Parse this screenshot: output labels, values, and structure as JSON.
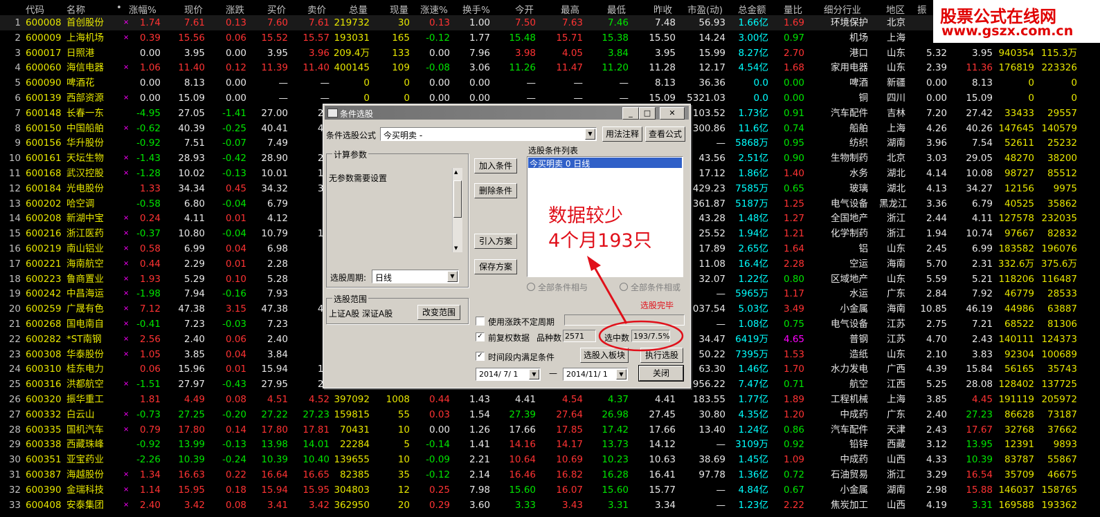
{
  "headers": [
    "代码",
    "名称",
    "•",
    "涨幅%",
    "现价",
    "涨跌",
    "买价",
    "卖价",
    "总量",
    "现量",
    "涨速%",
    "换手%",
    "今开",
    "最高",
    "最低",
    "昨收",
    "市盈(动)",
    "总金额",
    "量比",
    "细分行业",
    "地区",
    "振"
  ],
  "rows": [
    [
      "1",
      "600008",
      "首创股份",
      "×",
      "1.74",
      "7.61",
      "0.13",
      "7.60",
      "7.61",
      "219732",
      "30",
      "0.13",
      "1.00",
      "7.50",
      "7.63",
      "7.46",
      "7.48",
      "56.93",
      "1.66亿",
      "1.69",
      "环境保护",
      "北京",
      "",
      "",
      "",
      ""
    ],
    [
      "2",
      "600009",
      "上海机场",
      "×",
      "0.39",
      "15.56",
      "0.06",
      "15.52",
      "15.57",
      "193031",
      "165",
      "-0.12",
      "1.77",
      "15.48",
      "15.71",
      "15.38",
      "15.50",
      "14.24",
      "3.00亿",
      "0.97",
      "机场",
      "上海",
      "",
      "",
      "",
      ""
    ],
    [
      "3",
      "600017",
      "日照港",
      "",
      "0.00",
      "3.95",
      "0.00",
      "3.95",
      "3.96",
      "209.4万",
      "133",
      "0.00",
      "7.96",
      "3.98",
      "4.05",
      "3.84",
      "3.95",
      "15.99",
      "8.27亿",
      "2.70",
      "港口",
      "山东",
      "5.32",
      "3.95",
      "940354",
      "115.3万"
    ],
    [
      "4",
      "600060",
      "海信电器",
      "×",
      "1.06",
      "11.40",
      "0.12",
      "11.39",
      "11.40",
      "400145",
      "109",
      "-0.08",
      "3.06",
      "11.26",
      "11.47",
      "11.20",
      "11.28",
      "12.17",
      "4.54亿",
      "1.68",
      "家用电器",
      "山东",
      "2.39",
      "11.36",
      "176819",
      "223326"
    ],
    [
      "5",
      "600090",
      "啤酒花",
      "",
      "0.00",
      "8.13",
      "0.00",
      "—",
      "—",
      "0",
      "0",
      "0.00",
      "0.00",
      "—",
      "—",
      "—",
      "8.13",
      "36.36",
      "0.0",
      "0.00",
      "啤酒",
      "新疆",
      "0.00",
      "8.13",
      "0",
      "0"
    ],
    [
      "6",
      "600139",
      "西部资源",
      "×",
      "0.00",
      "15.09",
      "0.00",
      "—",
      "—",
      "0",
      "0",
      "0.00",
      "0.00",
      "—",
      "—",
      "—",
      "15.09",
      "5321.03",
      "0.0",
      "0.00",
      "铜",
      "四川",
      "0.00",
      "15.09",
      "0",
      "0"
    ],
    [
      "7",
      "600148",
      "长春一东",
      "",
      "-4.95",
      "27.05",
      "-1.41",
      "27.00",
      "27",
      "",
      "",
      "",
      "",
      "",
      "",
      "",
      "",
      "103.52",
      "1.73亿",
      "0.91",
      "汽车配件",
      "吉林",
      "7.20",
      "27.42",
      "33433",
      "29557"
    ],
    [
      "8",
      "600150",
      "中国船舶",
      "×",
      "-0.62",
      "40.39",
      "-0.25",
      "40.41",
      "40",
      "",
      "",
      "",
      "",
      "",
      "",
      "",
      "",
      "300.86",
      "11.6亿",
      "0.74",
      "船舶",
      "上海",
      "4.26",
      "40.26",
      "147645",
      "140579"
    ],
    [
      "9",
      "600156",
      "华升股份",
      "",
      "-0.92",
      "7.51",
      "-0.07",
      "7.49",
      "7",
      "",
      "",
      "",
      "",
      "",
      "",
      "",
      "",
      "—",
      "5868万",
      "0.95",
      "纺织",
      "湖南",
      "3.96",
      "7.54",
      "52611",
      "25232"
    ],
    [
      "10",
      "600161",
      "天坛生物",
      "×",
      "-1.43",
      "28.93",
      "-0.42",
      "28.90",
      "28",
      "",
      "",
      "",
      "",
      "",
      "",
      "",
      "",
      "43.56",
      "2.51亿",
      "0.90",
      "生物制药",
      "北京",
      "3.03",
      "29.05",
      "48270",
      "38200"
    ],
    [
      "11",
      "600168",
      "武汉控股",
      "×",
      "-1.28",
      "10.02",
      "-0.13",
      "10.01",
      "10",
      "",
      "",
      "",
      "",
      "",
      "",
      "",
      "",
      "17.12",
      "1.86亿",
      "1.40",
      "水务",
      "湖北",
      "4.14",
      "10.08",
      "98727",
      "85512"
    ],
    [
      "12",
      "600184",
      "光电股份",
      "",
      "1.33",
      "34.34",
      "0.45",
      "34.32",
      "34",
      "",
      "",
      "",
      "",
      "",
      "",
      "",
      "",
      "429.23",
      "7585万",
      "0.65",
      "玻璃",
      "湖北",
      "4.13",
      "34.27",
      "12156",
      "9975"
    ],
    [
      "13",
      "600202",
      "哈空调",
      "",
      "-0.58",
      "6.80",
      "-0.04",
      "6.79",
      "6",
      "",
      "",
      "",
      "",
      "",
      "",
      "",
      "",
      "361.87",
      "5187万",
      "1.25",
      "电气设备",
      "黑龙江",
      "3.36",
      "6.79",
      "40525",
      "35862"
    ],
    [
      "14",
      "600208",
      "新湖中宝",
      "×",
      "0.24",
      "4.11",
      "0.01",
      "4.12",
      "4",
      "",
      "",
      "",
      "",
      "",
      "",
      "",
      "",
      "43.28",
      "1.48亿",
      "1.27",
      "全国地产",
      "浙江",
      "2.44",
      "4.11",
      "127578",
      "232035"
    ],
    [
      "15",
      "600216",
      "浙江医药",
      "×",
      "-0.37",
      "10.80",
      "-0.04",
      "10.79",
      "10",
      "",
      "",
      "",
      "",
      "",
      "",
      "",
      "",
      "25.52",
      "1.94亿",
      "1.21",
      "化学制药",
      "浙江",
      "1.94",
      "10.74",
      "97667",
      "82832"
    ],
    [
      "16",
      "600219",
      "南山铝业",
      "×",
      "0.58",
      "6.99",
      "0.04",
      "6.98",
      "6",
      "",
      "",
      "",
      "",
      "",
      "",
      "",
      "",
      "17.89",
      "2.65亿",
      "1.64",
      "铝",
      "山东",
      "2.45",
      "6.99",
      "183582",
      "196076"
    ],
    [
      "17",
      "600221",
      "海南航空",
      "×",
      "0.44",
      "2.29",
      "0.01",
      "2.28",
      "2",
      "",
      "",
      "",
      "",
      "",
      "",
      "",
      "",
      "11.08",
      "16.4亿",
      "2.28",
      "空运",
      "海南",
      "5.70",
      "2.31",
      "332.6万",
      "375.6万"
    ],
    [
      "18",
      "600223",
      "鲁商置业",
      "×",
      "1.93",
      "5.29",
      "0.10",
      "5.28",
      "5",
      "",
      "",
      "",
      "",
      "",
      "",
      "",
      "",
      "32.07",
      "1.22亿",
      "0.80",
      "区域地产",
      "山东",
      "5.59",
      "5.21",
      "118206",
      "116487"
    ],
    [
      "19",
      "600242",
      "中昌海运",
      "×",
      "-1.98",
      "7.94",
      "-0.16",
      "7.93",
      "7",
      "",
      "",
      "",
      "",
      "",
      "",
      "",
      "",
      "—",
      "5965万",
      "1.17",
      "水运",
      "广东",
      "2.84",
      "7.92",
      "46779",
      "28533"
    ],
    [
      "20",
      "600259",
      "广晟有色",
      "×",
      "7.12",
      "47.38",
      "3.15",
      "47.38",
      "47",
      "",
      "",
      "",
      "",
      "",
      "",
      "",
      "",
      "1037.54",
      "5.03亿",
      "3.49",
      "小金属",
      "海南",
      "10.85",
      "46.19",
      "44986",
      "63887"
    ],
    [
      "21",
      "600268",
      "国电南自",
      "×",
      "-0.41",
      "7.23",
      "-0.03",
      "7.23",
      "7",
      "",
      "",
      "",
      "",
      "",
      "",
      "",
      "",
      "—",
      "1.08亿",
      "0.75",
      "电气设备",
      "江苏",
      "2.75",
      "7.21",
      "68522",
      "81306"
    ],
    [
      "22",
      "600282",
      "*ST南钢",
      "×",
      "2.56",
      "2.40",
      "0.06",
      "2.40",
      "2",
      "",
      "",
      "",
      "",
      "",
      "",
      "",
      "",
      "34.47",
      "6419万",
      "4.65",
      "普钢",
      "江苏",
      "4.70",
      "2.43",
      "140111",
      "124373"
    ],
    [
      "23",
      "600308",
      "华泰股份",
      "×",
      "1.05",
      "3.85",
      "0.04",
      "3.84",
      "3",
      "",
      "",
      "",
      "",
      "",
      "",
      "",
      "",
      "50.22",
      "7395万",
      "1.53",
      "造纸",
      "山东",
      "2.10",
      "3.83",
      "92304",
      "100689"
    ],
    [
      "24",
      "600310",
      "桂东电力",
      "",
      "0.06",
      "15.96",
      "0.01",
      "15.94",
      "15",
      "",
      "",
      "",
      "",
      "",
      "",
      "",
      "",
      "63.30",
      "1.46亿",
      "1.70",
      "水力发电",
      "广西",
      "4.39",
      "15.84",
      "56165",
      "35743"
    ],
    [
      "25",
      "600316",
      "洪都航空",
      "×",
      "-1.51",
      "27.97",
      "-0.43",
      "27.95",
      "27",
      "",
      "",
      "",
      "",
      "",
      "",
      "",
      "",
      "956.22",
      "7.47亿",
      "0.71",
      "航空",
      "江西",
      "5.25",
      "28.08",
      "128402",
      "137725"
    ],
    [
      "26",
      "600320",
      "振华重工",
      "",
      "1.81",
      "4.49",
      "0.08",
      "4.51",
      "4.52",
      "397092",
      "1008",
      "0.44",
      "1.43",
      "4.41",
      "4.54",
      "4.37",
      "4.41",
      "183.55",
      "1.77亿",
      "1.89",
      "工程机械",
      "上海",
      "3.85",
      "4.45",
      "191119",
      "205972"
    ],
    [
      "27",
      "600332",
      "白云山",
      "×",
      "-0.73",
      "27.25",
      "-0.20",
      "27.22",
      "27.23",
      "159815",
      "55",
      "0.03",
      "1.54",
      "27.39",
      "27.64",
      "26.98",
      "27.45",
      "30.80",
      "4.35亿",
      "1.20",
      "中成药",
      "广东",
      "2.40",
      "27.23",
      "86628",
      "73187"
    ],
    [
      "28",
      "600335",
      "国机汽车",
      "×",
      "0.79",
      "17.80",
      "0.14",
      "17.80",
      "17.81",
      "70431",
      "10",
      "0.00",
      "1.26",
      "17.66",
      "17.85",
      "17.42",
      "17.66",
      "13.40",
      "1.24亿",
      "0.86",
      "汽车配件",
      "天津",
      "2.43",
      "17.67",
      "32768",
      "37662"
    ],
    [
      "29",
      "600338",
      "西藏珠峰",
      "",
      "-0.92",
      "13.99",
      "-0.13",
      "13.98",
      "14.01",
      "22284",
      "5",
      "-0.14",
      "1.41",
      "14.16",
      "14.17",
      "13.73",
      "14.12",
      "—",
      "3109万",
      "0.92",
      "铅锌",
      "西藏",
      "3.12",
      "13.95",
      "12391",
      "9893"
    ],
    [
      "30",
      "600351",
      "亚宝药业",
      "",
      "-2.26",
      "10.39",
      "-0.24",
      "10.39",
      "10.40",
      "139655",
      "10",
      "-0.09",
      "2.21",
      "10.64",
      "10.69",
      "10.23",
      "10.63",
      "38.69",
      "1.45亿",
      "1.09",
      "中成药",
      "山西",
      "4.33",
      "10.39",
      "83787",
      "55867"
    ],
    [
      "31",
      "600387",
      "海越股份",
      "×",
      "1.34",
      "16.63",
      "0.22",
      "16.64",
      "16.65",
      "82385",
      "35",
      "-0.12",
      "2.14",
      "16.46",
      "16.82",
      "16.28",
      "16.41",
      "97.78",
      "1.36亿",
      "0.72",
      "石油贸易",
      "浙江",
      "3.29",
      "16.54",
      "35709",
      "46675"
    ],
    [
      "32",
      "600390",
      "金瑞科技",
      "×",
      "1.14",
      "15.95",
      "0.18",
      "15.94",
      "15.95",
      "304803",
      "12",
      "0.25",
      "7.98",
      "15.60",
      "16.07",
      "15.60",
      "15.77",
      "—",
      "4.84亿",
      "0.67",
      "小金属",
      "湖南",
      "2.98",
      "15.88",
      "146037",
      "158765"
    ],
    [
      "33",
      "600408",
      "安泰集团",
      "×",
      "2.40",
      "3.42",
      "0.08",
      "3.41",
      "3.42",
      "362950",
      "20",
      "0.29",
      "3.60",
      "3.33",
      "3.43",
      "3.31",
      "3.34",
      "—",
      "1.23亿",
      "2.22",
      "焦炭加工",
      "山西",
      "4.19",
      "3.31",
      "169588",
      "193362"
    ]
  ],
  "dialog": {
    "title": "条件选股",
    "win_min": "_",
    "win_max": "□",
    "win_close": "✕",
    "formula_label": "条件选股公式",
    "formula_value": "今买明卖 -",
    "usage_btn": "用法注释",
    "view_btn": "查看公式",
    "params_group": "计算参数",
    "params_text": "无参数需要设置",
    "period_label": "选股周期:",
    "period_value": "日线",
    "add_btn": "加入条件",
    "del_btn": "删除条件",
    "import_btn": "引入方案",
    "save_btn": "保存方案",
    "cond_list_label": "选股条件列表",
    "cond_item": "今买明卖  0  日线",
    "radio_and": "全部条件相与",
    "radio_or": "全部条件相或",
    "range_group": "选股范围",
    "range_text": "上证A股  深证A股",
    "change_range_btn": "改变范围",
    "chk_period": "使用涨跌不定周期",
    "chk_adj": "前复权数据",
    "count_label": "品种数",
    "count_value": "2571",
    "selected_label": "选中数",
    "selected_value": "193/7.5%",
    "chk_time": "时间段内满足条件",
    "to_board_btn": "选股入板块",
    "run_btn": "执行选股",
    "date_from": "2014/ 7/ 1",
    "dash": "—",
    "date_to": "2014/11/ 1",
    "close_btn": "关闭",
    "status_done": "选股完毕"
  },
  "annotation": {
    "line1": "数据较少",
    "line2": "4个月193只"
  },
  "watermark": {
    "line1": "股票公式在线网",
    "line2": "www.gszx.com.cn"
  }
}
